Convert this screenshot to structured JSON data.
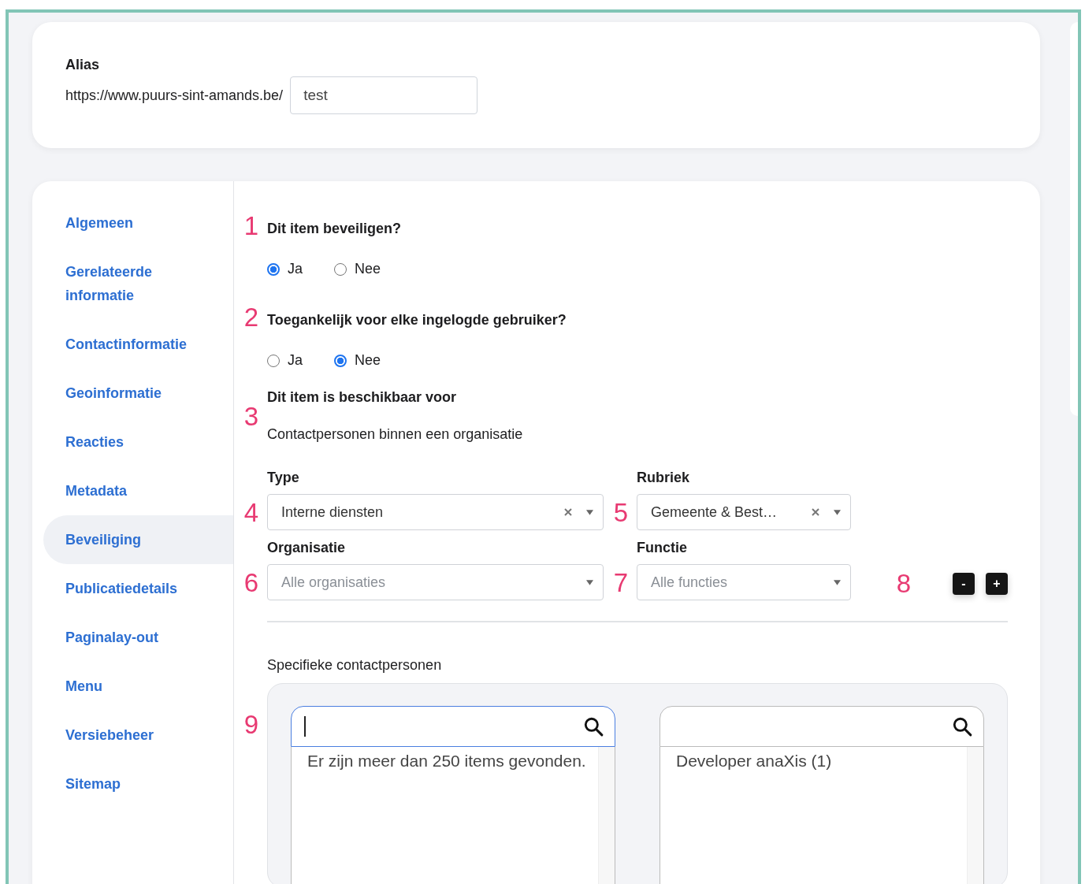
{
  "alias": {
    "label": "Alias",
    "prefix": "https://www.puurs-sint-amands.be/",
    "value": "test"
  },
  "sidebar": {
    "items": [
      {
        "label": "Algemeen",
        "selected": false
      },
      {
        "label": "Gerelateerde informatie",
        "selected": false
      },
      {
        "label": "Contactinformatie",
        "selected": false
      },
      {
        "label": "Geoinformatie",
        "selected": false
      },
      {
        "label": "Reacties",
        "selected": false
      },
      {
        "label": "Metadata",
        "selected": false
      },
      {
        "label": "Beveiliging",
        "selected": true
      },
      {
        "label": "Publicatiedetails",
        "selected": false
      },
      {
        "label": "Paginalay-out",
        "selected": false
      },
      {
        "label": "Menu",
        "selected": false
      },
      {
        "label": "Versiebeheer",
        "selected": false
      },
      {
        "label": "Sitemap",
        "selected": false
      }
    ]
  },
  "questions": [
    {
      "number": "1",
      "label": "Dit item beveiligen?",
      "options": [
        {
          "label": "Ja",
          "selected": true
        },
        {
          "label": "Nee",
          "selected": false
        }
      ]
    },
    {
      "number": "2",
      "label": "Toegankelijk voor elke ingelogde gebruiker?",
      "options": [
        {
          "label": "Ja",
          "selected": false
        },
        {
          "label": "Nee",
          "selected": true
        }
      ]
    }
  ],
  "availability": {
    "number": "3",
    "title": "Dit item is beschikbaar voor",
    "subtitle": "Contactpersonen binnen een organisatie"
  },
  "filters": [
    {
      "number": "4",
      "label": "Type",
      "value": "Interne diensten",
      "clearable": true
    },
    {
      "number": "5",
      "label": "Rubriek",
      "value": "Gemeente & Best…",
      "clearable": true
    },
    {
      "number": "6",
      "label": "Organisatie",
      "placeholder": "Alle organisaties",
      "clearable": false
    },
    {
      "number": "7",
      "label": "Functie",
      "placeholder": "Alle functies",
      "clearable": false
    }
  ],
  "row_controls": {
    "number": "8",
    "buttons": [
      "-",
      "+"
    ]
  },
  "specific": {
    "label": "Specifieke contactpersonen",
    "number": "9",
    "lists": [
      {
        "focused": true,
        "items": [
          "Er zijn meer dan 250 items gevonden."
        ]
      },
      {
        "focused": false,
        "items": [
          "Developer anaXis (1)"
        ]
      }
    ]
  }
}
